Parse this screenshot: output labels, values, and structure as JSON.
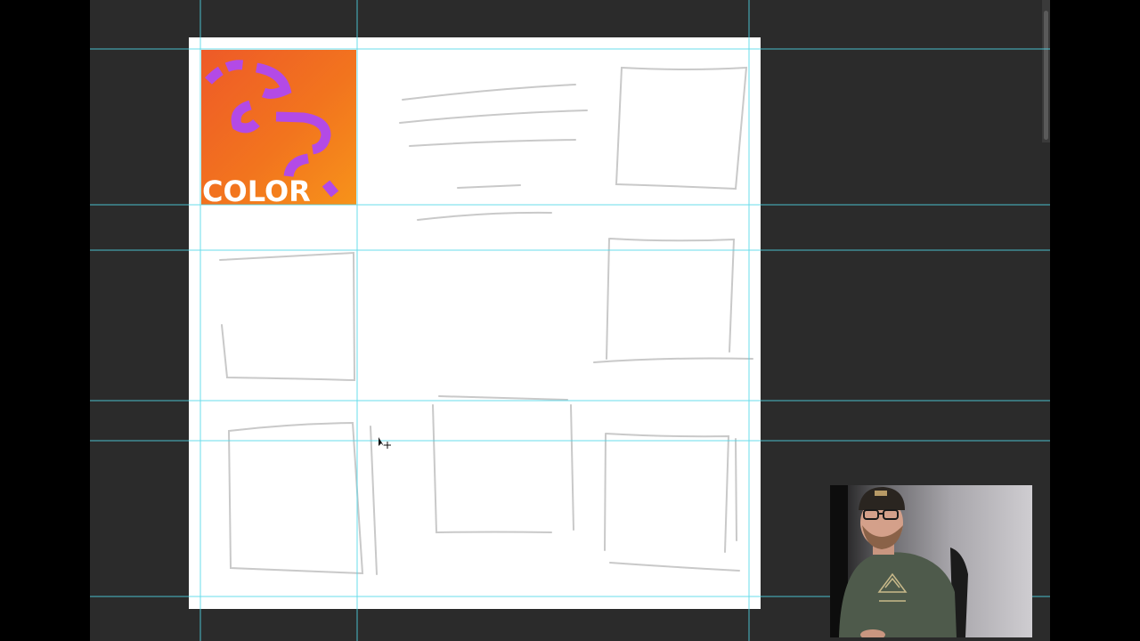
{
  "thumbnail": {
    "word": "COLOR",
    "colors": {
      "gradient_start": "#ee5a28",
      "gradient_end": "#f7931a",
      "squiggle": "#b34ae6"
    }
  },
  "guides": {
    "color": "#4fd6e8"
  },
  "workspace": {
    "background": "#2b2b2b"
  },
  "cursor": {
    "icon": "move-cursor-icon"
  },
  "webcam": {
    "label": "presenter-webcam"
  }
}
